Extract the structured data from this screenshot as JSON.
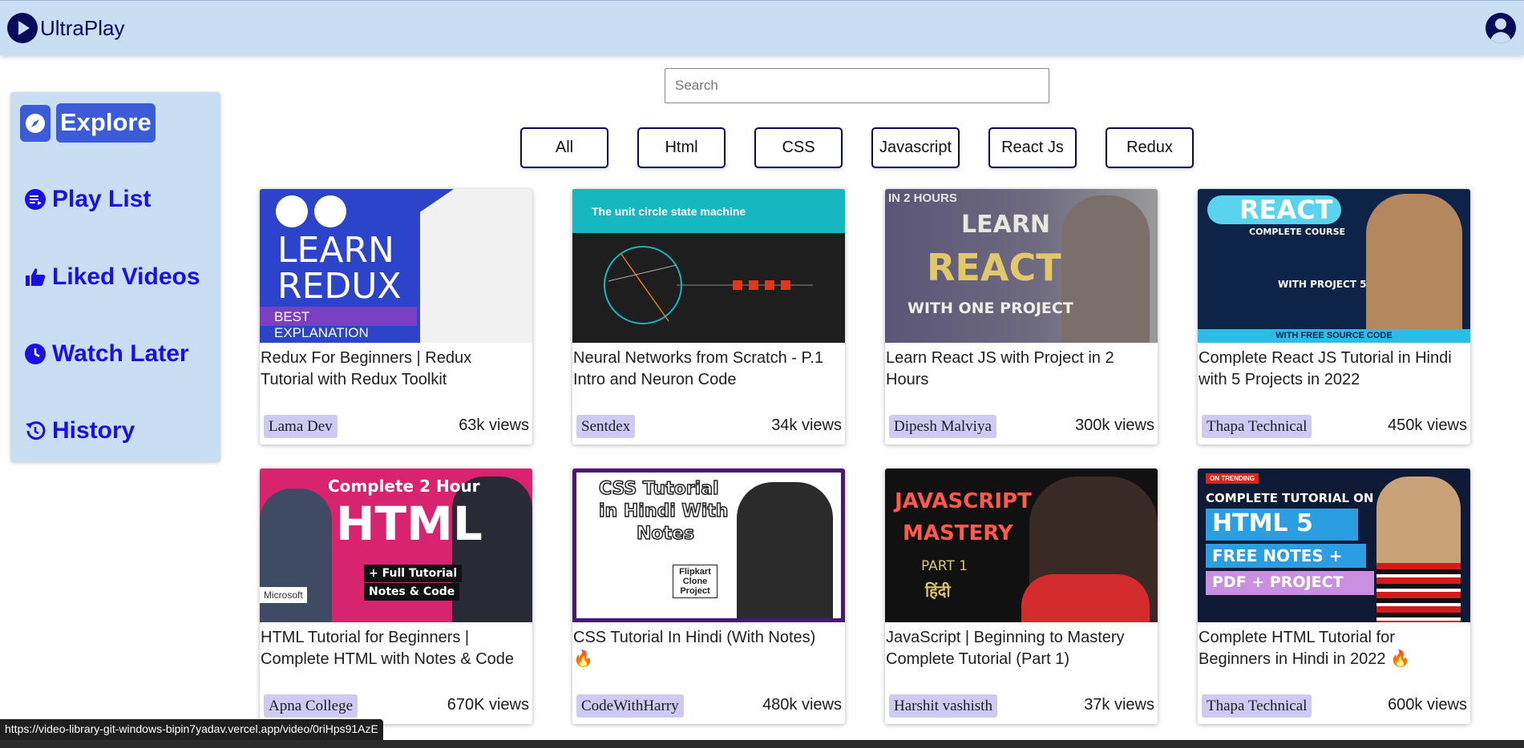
{
  "app": {
    "name": "UltraPlay"
  },
  "search": {
    "placeholder": "Search",
    "value": ""
  },
  "sidebar": {
    "items": [
      {
        "label": "Explore",
        "icon": "compass-icon",
        "active": true
      },
      {
        "label": "Play List",
        "icon": "playlist-add-icon",
        "active": false
      },
      {
        "label": "Liked Videos",
        "icon": "thumbs-up-icon",
        "active": false
      },
      {
        "label": "Watch Later",
        "icon": "clock-icon",
        "active": false
      },
      {
        "label": "History",
        "icon": "history-icon",
        "active": false
      }
    ]
  },
  "filters": [
    {
      "label": "All"
    },
    {
      "label": "Html"
    },
    {
      "label": "CSS"
    },
    {
      "label": "Javascript"
    },
    {
      "label": "React Js"
    },
    {
      "label": "Redux"
    }
  ],
  "videos": [
    {
      "title": "Redux For Beginners | Redux Tutorial with Redux Toolkit",
      "channel": "Lama Dev",
      "views": "63k views",
      "thumb": {
        "bg": "#2c44c9",
        "lines": [
          "LEARN",
          "REDUX"
        ],
        "badge": "BEST EXPLANATION"
      }
    },
    {
      "title": "Neural Networks from Scratch - P.1 Intro and Neuron Code",
      "channel": "Sentdex",
      "views": "34k views",
      "thumb": {
        "bg": "#1e1e1e",
        "band": "#15b8c0",
        "caption": "The unit circle state machine"
      }
    },
    {
      "title": "Learn React JS with Project in 2 Hours",
      "channel": "Dipesh Malviya",
      "views": "300k views",
      "thumb": {
        "bg": "#5b5577",
        "corner": "IN 2 HOURS",
        "lines": [
          "LEARN",
          "REACT",
          "WITH ONE PROJECT"
        ]
      }
    },
    {
      "title": "Complete React JS Tutorial in Hindi with 5 Projects in 2022",
      "channel": "Thapa Technical",
      "views": "450k views",
      "thumb": {
        "bg": "#0d2347",
        "lines": [
          "REACT",
          "COMPLETE COURSE",
          "WITH PROJECT 5"
        ],
        "footer": "WITH FREE SOURCE CODE"
      }
    },
    {
      "title": "HTML Tutorial for Beginners | Complete HTML with Notes & Code",
      "channel": "Apna College",
      "views": "670K views",
      "thumb": {
        "bg": "#d8236f",
        "lines": [
          "Complete 2 Hour",
          "HTML",
          "+ Full Tutorial",
          "Notes & Code"
        ],
        "badge": "Microsoft"
      }
    },
    {
      "title": "CSS Tutorial In Hindi (With Notes) 🔥",
      "channel": "CodeWithHarry",
      "views": "480k views",
      "thumb": {
        "bg": "#ffffff",
        "border": "#4a1a72",
        "lines": [
          "CSS Tutorial",
          "in Hindi With",
          "Notes"
        ],
        "badge": "Flipkart Clone Project"
      }
    },
    {
      "title": "JavaScript | Beginning to Mastery Complete Tutorial (Part 1)",
      "channel": "Harshit vashisth",
      "views": "37k views",
      "thumb": {
        "bg": "#111111",
        "lines": [
          "JAVASCRIPT",
          "MASTERY",
          "PART 1",
          "हिंदी"
        ]
      }
    },
    {
      "title": "Complete HTML Tutorial for Beginners in Hindi in 2022 🔥",
      "channel": "Thapa Technical",
      "views": "600k views",
      "thumb": {
        "bg": "#0f1b36",
        "corner": "ON TRENDING",
        "lines": [
          "COMPLETE TUTORIAL ON",
          "HTML 5",
          "FREE NOTES +",
          "PDF + PROJECT"
        ]
      }
    }
  ],
  "statusbar": {
    "url": "https://video-library-git-windows-bipin7yadav.vercel.app/video/0riHps91AzE"
  }
}
